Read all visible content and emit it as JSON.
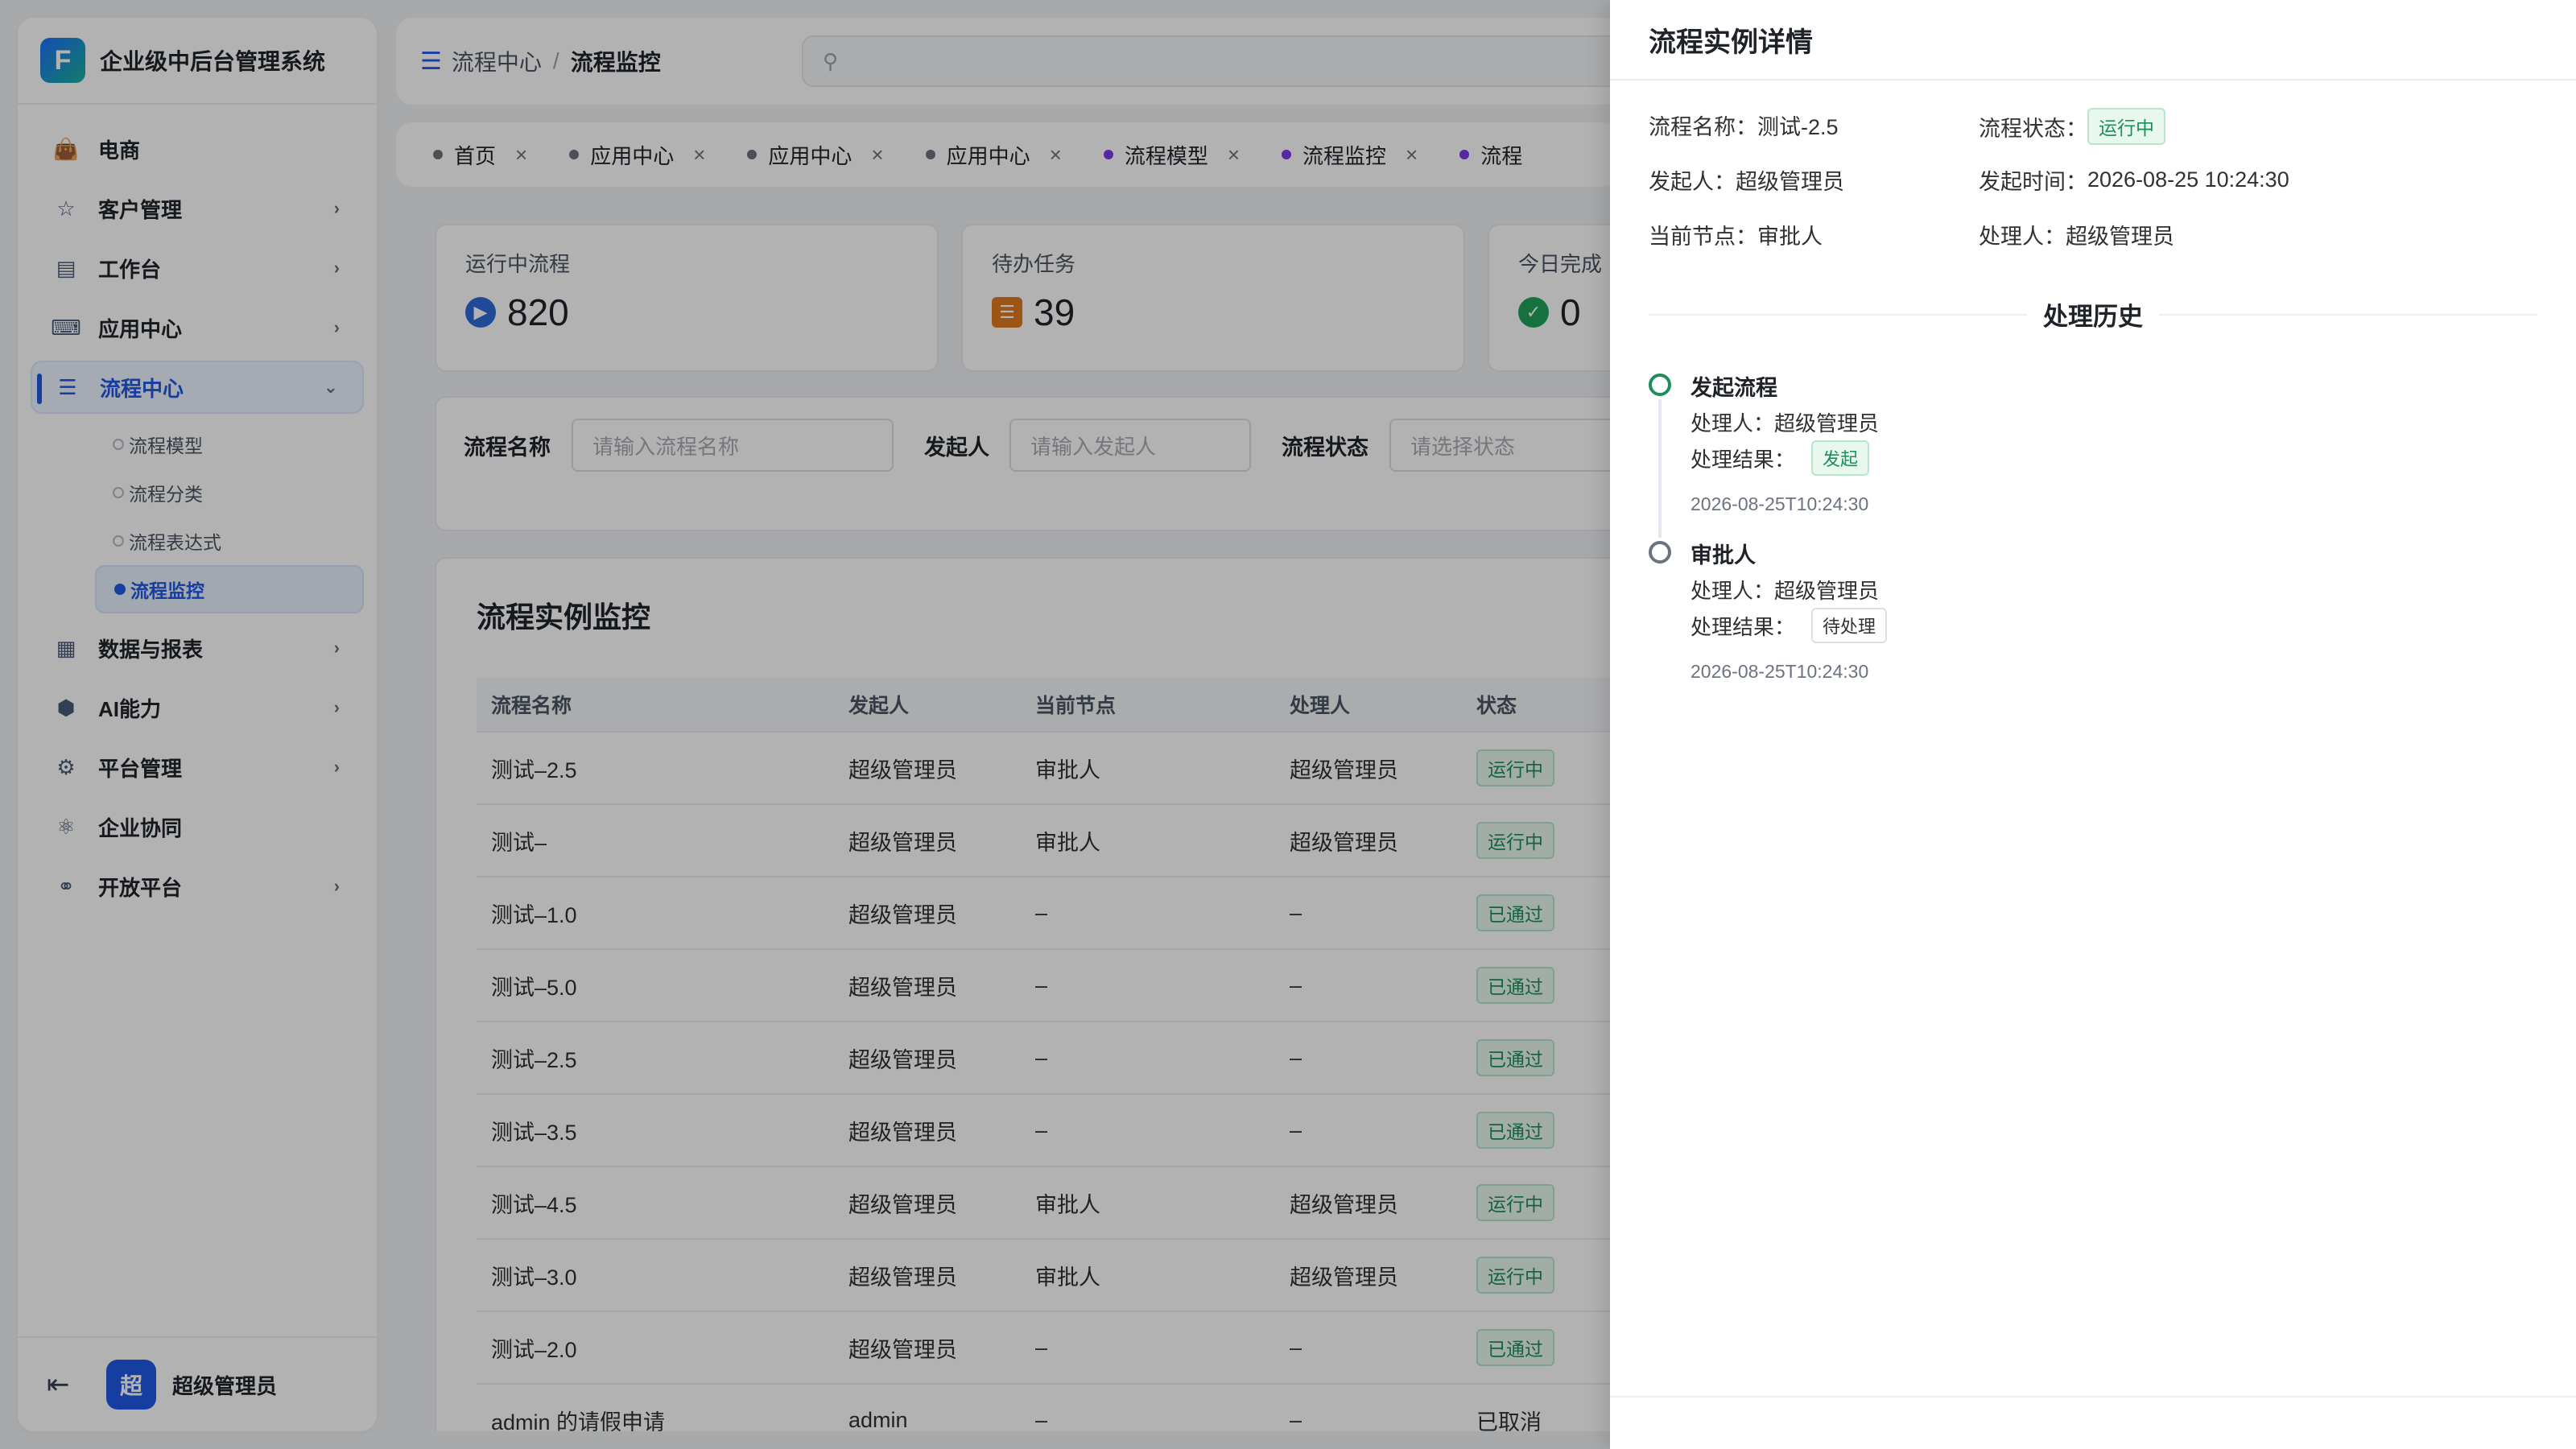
{
  "sidebar": {
    "brand_title": "企业级中后台管理系统",
    "menu": [
      {
        "label": "电商",
        "icon": "shopping-bag-icon"
      },
      {
        "label": "客户管理",
        "icon": "person-icon"
      },
      {
        "label": "工作台",
        "icon": "clipboard-icon"
      },
      {
        "label": "应用中心",
        "icon": "keyboard-icon"
      },
      {
        "label": "流程中心",
        "icon": "flow-icon"
      }
    ],
    "submenu": [
      "流程模型",
      "流程分类",
      "流程表达式",
      "流程监控"
    ],
    "menu_after": [
      {
        "label": "数据与报表",
        "icon": "chart-icon"
      },
      {
        "label": "AI能力",
        "icon": "ai-icon"
      },
      {
        "label": "平台管理",
        "icon": "platform-icon"
      },
      {
        "label": "企业协同",
        "icon": "cooperation-icon"
      },
      {
        "label": "开放平台",
        "icon": "planet-icon"
      }
    ],
    "user_avatar": "超",
    "user_name": "超级管理员"
  },
  "header": {
    "breadcrumb": [
      "流程中心",
      "流程监控"
    ],
    "breadcrumb_sep": "/"
  },
  "tabs": [
    {
      "label": "首页",
      "color": "gray"
    },
    {
      "label": "应用中心",
      "color": "gray"
    },
    {
      "label": "应用中心",
      "color": "gray"
    },
    {
      "label": "应用中心",
      "color": "gray"
    },
    {
      "label": "流程模型",
      "color": "purple"
    },
    {
      "label": "流程监控",
      "color": "purple"
    },
    {
      "label": "流程",
      "color": "purple"
    }
  ],
  "stats": [
    {
      "label": "运行中流程",
      "value": "820",
      "color": "#2f6bd9"
    },
    {
      "label": "待办任务",
      "value": "39",
      "color": "#e07a1f"
    },
    {
      "label": "今日完成",
      "value": "0",
      "color": "#22a35a"
    }
  ],
  "filter": {
    "name_label": "流程名称",
    "name_placeholder": "请输入流程名称",
    "starter_label": "发起人",
    "starter_placeholder": "请输入发起人",
    "status_label": "流程状态",
    "status_placeholder": "请选择状态"
  },
  "table": {
    "title": "流程实例监控",
    "columns": [
      "流程名称",
      "发起人",
      "当前节点",
      "处理人",
      "状态"
    ],
    "rows": [
      {
        "name": "测试–2.5",
        "starter": "超级管理员",
        "node": "审批人",
        "handler": "超级管理员",
        "status": "运行中",
        "tag": true
      },
      {
        "name": "测试–",
        "starter": "超级管理员",
        "node": "审批人",
        "handler": "超级管理员",
        "status": "运行中",
        "tag": true
      },
      {
        "name": "测试–1.0",
        "starter": "超级管理员",
        "node": "–",
        "handler": "–",
        "status": "已通过",
        "tag": true
      },
      {
        "name": "测试–5.0",
        "starter": "超级管理员",
        "node": "–",
        "handler": "–",
        "status": "已通过",
        "tag": true
      },
      {
        "name": "测试–2.5",
        "starter": "超级管理员",
        "node": "–",
        "handler": "–",
        "status": "已通过",
        "tag": true
      },
      {
        "name": "测试–3.5",
        "starter": "超级管理员",
        "node": "–",
        "handler": "–",
        "status": "已通过",
        "tag": true
      },
      {
        "name": "测试–4.5",
        "starter": "超级管理员",
        "node": "审批人",
        "handler": "超级管理员",
        "status": "运行中",
        "tag": true
      },
      {
        "name": "测试–3.0",
        "starter": "超级管理员",
        "node": "审批人",
        "handler": "超级管理员",
        "status": "运行中",
        "tag": true
      },
      {
        "name": "测试–2.0",
        "starter": "超级管理员",
        "node": "–",
        "handler": "–",
        "status": "已通过",
        "tag": true
      },
      {
        "name": "admin 的请假申请",
        "starter": "admin",
        "node": "–",
        "handler": "–",
        "status": "已取消",
        "tag": false
      }
    ]
  },
  "drawer": {
    "title": "流程实例详情",
    "name_label": "流程名称：",
    "name_value": "测试-2.5",
    "status_label": "流程状态：",
    "status_value": "运行中",
    "starter_label": "发起人：",
    "starter_value": "超级管理员",
    "start_time_label": "发起时间：",
    "start_time_value": "2026-08-25 10:24:30",
    "node_label": "当前节点：",
    "node_value": "审批人",
    "handler_label": "处理人：",
    "handler_value": "超级管理员",
    "history_title": "处理历史",
    "history": [
      {
        "title": "发起流程",
        "handler": "处理人：超级管理员",
        "result_label": "处理结果：",
        "result": "发起",
        "time": "2026-08-25T10:24:30"
      },
      {
        "title": "审批人",
        "handler": "处理人：超级管理员",
        "result_label": "处理结果：",
        "result": "待处理",
        "time": "2026-08-25T10:24:30"
      }
    ]
  }
}
